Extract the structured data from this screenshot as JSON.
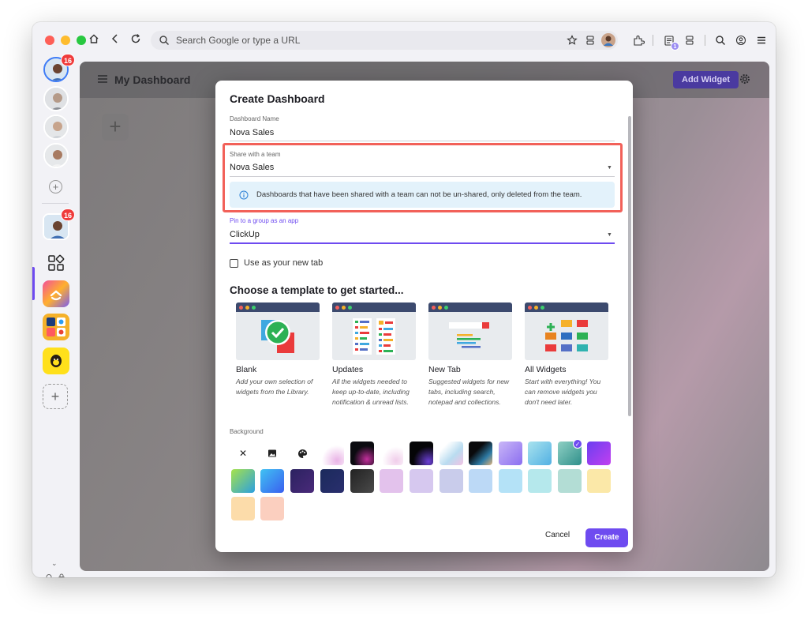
{
  "browser": {
    "url_placeholder": "Search Google or type a URL",
    "reading_list_count": "1"
  },
  "rail": {
    "top_avatar_badge": "16",
    "group_avatar_badge": "16"
  },
  "dashboard": {
    "title": "My Dashboard",
    "add_widget_label": "Add Widget"
  },
  "modal": {
    "title": "Create Dashboard",
    "name_label": "Dashboard Name",
    "name_value": "Nova Sales",
    "team_label": "Share with a team",
    "team_value": "Nova Sales",
    "info_text": "Dashboards that have been shared with a team can not be un-shared, only deleted from the team.",
    "pin_label": "Pin to a group as an app",
    "pin_value": "ClickUp",
    "newtab_label": "Use as your new tab",
    "template_heading": "Choose a template to get started...",
    "templates": [
      {
        "name": "Blank",
        "desc": "Add your own selection of widgets from the Library."
      },
      {
        "name": "Updates",
        "desc": "All the widgets needed to keep up-to-date, including notification & unread lists."
      },
      {
        "name": "New Tab",
        "desc": "Suggested widgets for new tabs, including search, notepad and collections."
      },
      {
        "name": "All Widgets",
        "desc": "Start with everything! You can remove widgets you don't need later."
      }
    ],
    "background_label": "Background",
    "cancel_label": "Cancel",
    "create_label": "Create"
  },
  "colors": {
    "accent": "#6e4bf0",
    "highlight": "#f26159",
    "info_bg": "#e3f2fb"
  }
}
